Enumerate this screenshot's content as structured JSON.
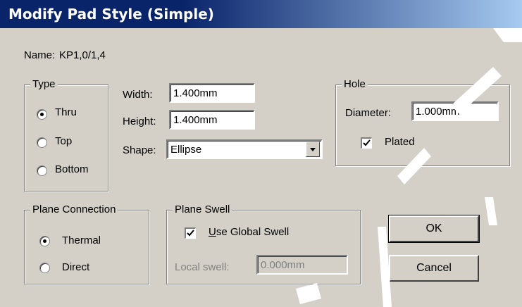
{
  "window": {
    "title": "Modify Pad Style (Simple)"
  },
  "name_row": {
    "label": "Name:",
    "value": "KP1,0/1,4"
  },
  "type_group": {
    "legend": "Type",
    "options": [
      {
        "label": "Thru",
        "selected": true
      },
      {
        "label": "Top",
        "selected": false
      },
      {
        "label": "Bottom",
        "selected": false
      }
    ]
  },
  "dimensions": {
    "width_label": "Width:",
    "width_value": "1.400mm",
    "height_label": "Height:",
    "height_value": "1.400mm",
    "shape_label": "Shape:",
    "shape_value": "Ellipse"
  },
  "hole_group": {
    "legend": "Hole",
    "diameter_label": "Diameter:",
    "diameter_value": "1.000mm",
    "plated_label": "Plated",
    "plated_checked": true
  },
  "plane_connection": {
    "legend": "Plane Connection",
    "options": [
      {
        "label": "Thermal",
        "selected": true
      },
      {
        "label": "Direct",
        "selected": false
      }
    ]
  },
  "plane_swell": {
    "legend": "Plane Swell",
    "use_global_prefix": "U",
    "use_global_rest": "se Global Swell",
    "use_global_checked": true,
    "local_swell_label": "Local swell:",
    "local_swell_value": "0.000mm"
  },
  "buttons": {
    "ok_label": "OK",
    "cancel_label": "Cancel"
  },
  "colors": {
    "title_bar": "#0a246a",
    "dialog_face": "#d4d0c8"
  }
}
